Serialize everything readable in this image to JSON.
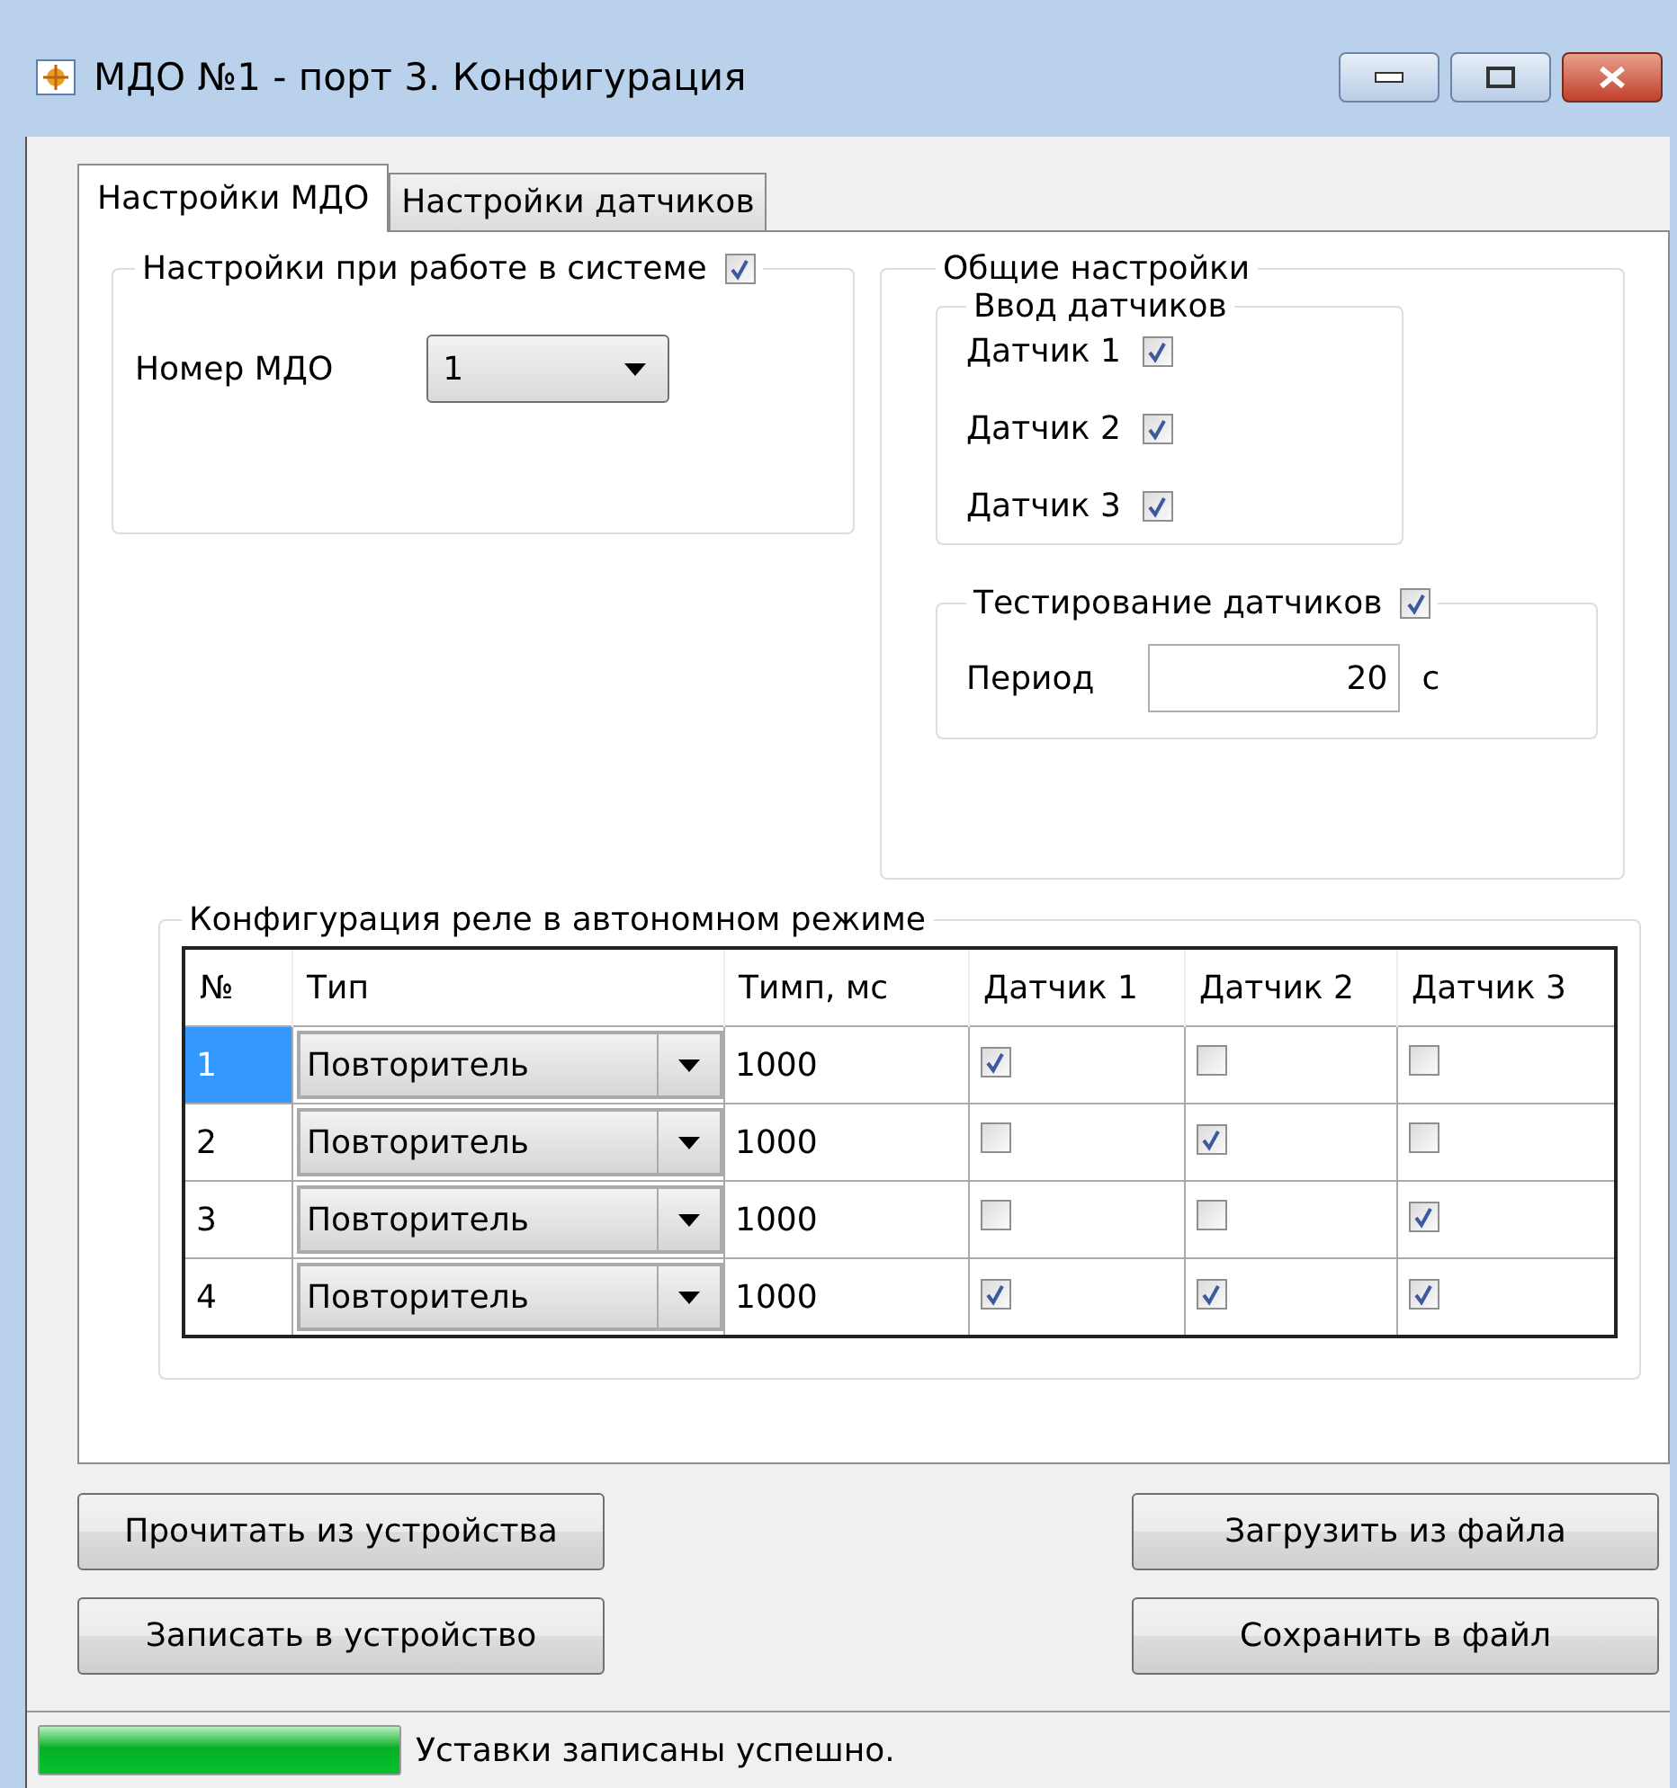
{
  "window": {
    "title": "МДО №1 - порт 3. Конфигурация"
  },
  "tabs": [
    {
      "label": "Настройки МДО",
      "selected": true
    },
    {
      "label": "Настройки датчиков",
      "selected": false
    }
  ],
  "system_group": {
    "title": "Настройки при работе в системе",
    "checked": true,
    "mdo_number": {
      "label": "Номер МДО",
      "value": "1"
    }
  },
  "general_group": {
    "title": "Общие настройки",
    "sensor_input": {
      "title": "Ввод датчиков",
      "sensors": [
        {
          "label": "Датчик 1",
          "checked": true
        },
        {
          "label": "Датчик 2",
          "checked": true
        },
        {
          "label": "Датчик 3",
          "checked": true
        }
      ]
    },
    "testing": {
      "title": "Тестирование датчиков",
      "checked": true,
      "period": {
        "label": "Период",
        "value": "20",
        "unit": "с"
      }
    }
  },
  "relay_group": {
    "title": "Конфигурация реле в автономном режиме",
    "table": {
      "columns": [
        "№",
        "Тип",
        "Тимп, мс",
        "Датчик 1",
        "Датчик 2",
        "Датчик 3"
      ],
      "rows": [
        {
          "number": "1",
          "selected": true,
          "type": "Повторитель",
          "time": "1000",
          "sensors": [
            true,
            false,
            false
          ]
        },
        {
          "number": "2",
          "selected": false,
          "type": "Повторитель",
          "time": "1000",
          "sensors": [
            false,
            true,
            false
          ]
        },
        {
          "number": "3",
          "selected": false,
          "type": "Повторитель",
          "time": "1000",
          "sensors": [
            false,
            false,
            true
          ]
        },
        {
          "number": "4",
          "selected": false,
          "type": "Повторитель",
          "time": "1000",
          "sensors": [
            true,
            true,
            true
          ]
        }
      ]
    }
  },
  "buttons_left": [
    "Прочитать из устройства",
    "Записать в устройство"
  ],
  "buttons_right": [
    "Загрузить из файла",
    "Сохранить в файл"
  ],
  "status_bar": {
    "level": 1,
    "text": "Уставки записаны успешно."
  }
}
